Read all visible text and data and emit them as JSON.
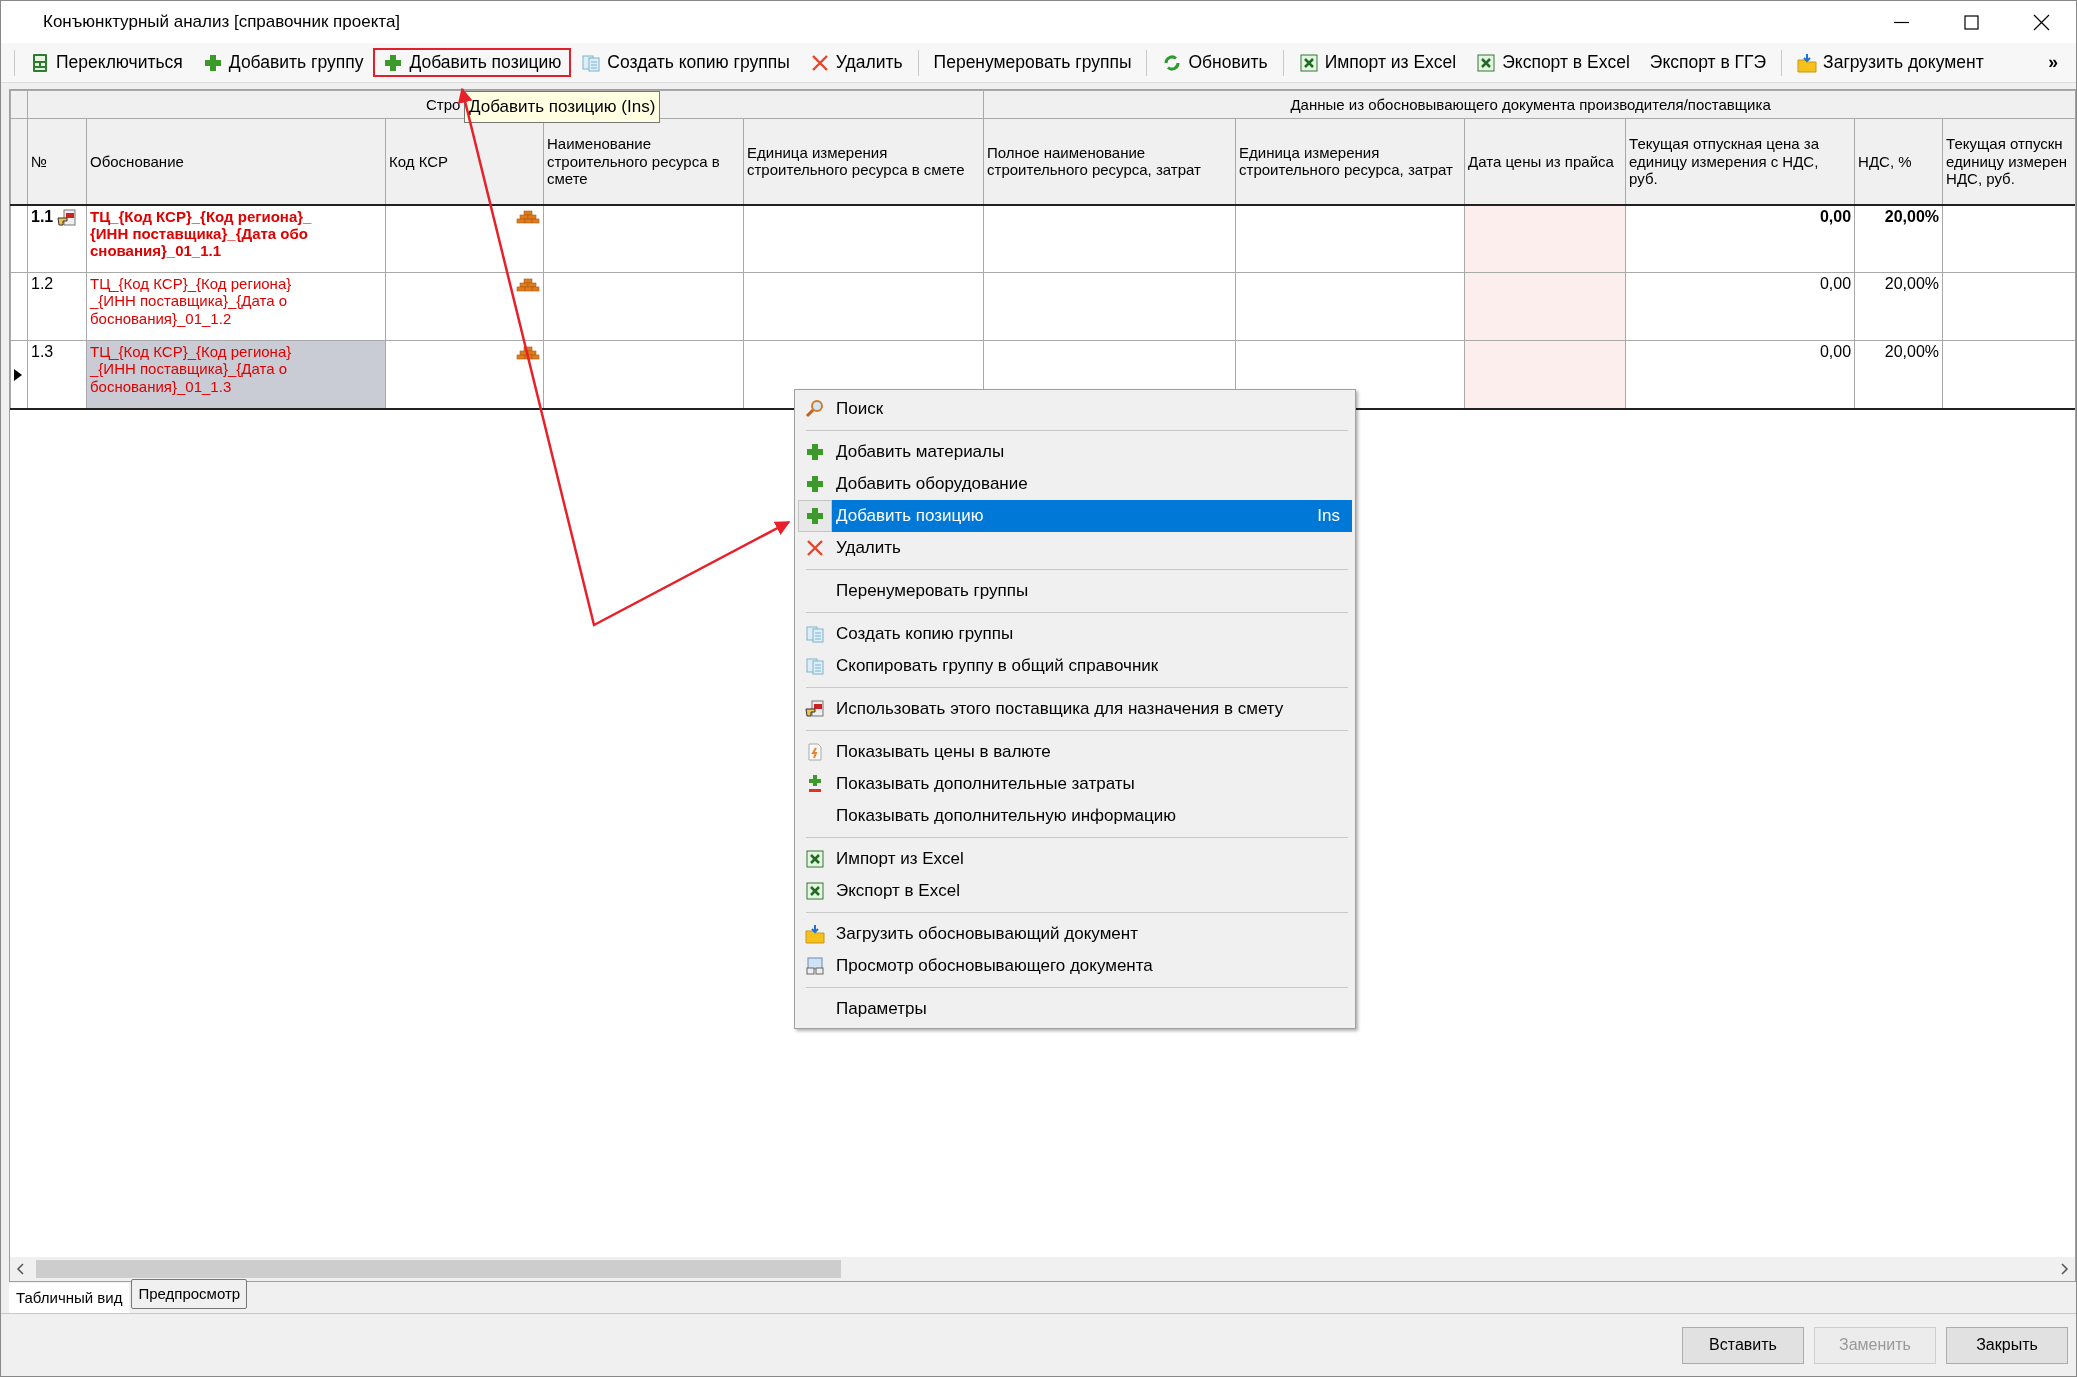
{
  "window": {
    "title": "Конъюнктурный анализ [справочник проекта]"
  },
  "toolbar": [
    {
      "kind": "button",
      "label": "Переключиться",
      "highlighted": false
    },
    {
      "kind": "button",
      "label": "Добавить группу",
      "highlighted": false
    },
    {
      "kind": "button",
      "label": "Добавить позицию",
      "highlighted": true
    },
    {
      "kind": "button",
      "label": "Создать копию группы",
      "highlighted": false
    },
    {
      "kind": "button",
      "label": "Удалить",
      "highlighted": false
    },
    {
      "kind": "separator"
    },
    {
      "kind": "button",
      "label": "Перенумеровать группы",
      "highlighted": false
    },
    {
      "kind": "separator"
    },
    {
      "kind": "button",
      "label": "Обновить",
      "highlighted": false
    },
    {
      "kind": "separator"
    },
    {
      "kind": "button",
      "label": "Импорт из Excel",
      "highlighted": false
    },
    {
      "kind": "button",
      "label": "Экспорт в Excel",
      "highlighted": false
    },
    {
      "kind": "button",
      "label": "Экспорт в ГГЭ",
      "highlighted": false
    },
    {
      "kind": "separator"
    },
    {
      "kind": "button",
      "label": "Загрузить документ",
      "highlighted": false
    }
  ],
  "toolbar_overflow": "»",
  "tooltip": "Добавить позицию (Ins)",
  "table": {
    "groups": [
      {
        "label": "Стро"
      },
      {
        "label": "Данные из обосновывающего документа производителя/поставщика"
      }
    ],
    "columns": [
      "№",
      "Обоснование",
      "Код КСР",
      "Наименование строительного ресурса в смете",
      "Единица измерения строительного ресурса в смете",
      "Полное наименование строительного ресурса, затрат",
      "Единица измерения строительного ресурса, затрат",
      "Дата цены из прайса",
      "Текущая отпускная цена за единицу измерения с НДС, руб.",
      "НДС, %",
      "Текущая отпускн\nединицу измерен\nНДС, руб."
    ],
    "rows": [
      {
        "kind": "group",
        "number": "1.1",
        "basis": "ТЦ_{Код КСР}_{Код региона}_{ИНН поставщика}_{Дата обоснования}_01_1.1",
        "price": "0,00",
        "vat": "20,00%",
        "selected": false
      },
      {
        "kind": "position",
        "number": "1.2",
        "basis": "ТЦ_{Код КСР}_{Код региона}_{ИНН поставщика}_{Дата обоснования}_01_1.2",
        "price": "0,00",
        "vat": "20,00%",
        "selected": false
      },
      {
        "kind": "position",
        "number": "1.3",
        "basis": "ТЦ_{Код КСР}_{Код региона}_{ИНН поставщика}_{Дата обоснования}_01_1.3",
        "price": "0,00",
        "vat": "20,00%",
        "selected": true
      }
    ]
  },
  "context_menu": {
    "items": [
      {
        "kind": "item",
        "label": "Поиск",
        "selected": false
      },
      {
        "kind": "separator"
      },
      {
        "kind": "item",
        "label": "Добавить материалы",
        "selected": false
      },
      {
        "kind": "item",
        "label": "Добавить оборудование",
        "selected": false
      },
      {
        "kind": "item",
        "label": "Добавить позицию",
        "shortcut": "Ins",
        "selected": true
      },
      {
        "kind": "item",
        "label": "Удалить",
        "selected": false
      },
      {
        "kind": "separator"
      },
      {
        "kind": "item",
        "label": "Перенумеровать группы",
        "selected": false
      },
      {
        "kind": "separator"
      },
      {
        "kind": "item",
        "label": "Создать копию группы",
        "selected": false
      },
      {
        "kind": "item",
        "label": "Скопировать группу в общий справочник",
        "selected": false
      },
      {
        "kind": "separator"
      },
      {
        "kind": "item",
        "label": "Использовать этого поставщика для назначения в смету",
        "selected": false
      },
      {
        "kind": "separator"
      },
      {
        "kind": "item",
        "label": "Показывать цены в валюте",
        "selected": false
      },
      {
        "kind": "item",
        "label": "Показывать дополнительные затраты",
        "selected": false
      },
      {
        "kind": "item",
        "label": "Показывать дополнительную информацию",
        "selected": false
      },
      {
        "kind": "separator"
      },
      {
        "kind": "item",
        "label": "Импорт из Excel",
        "selected": false
      },
      {
        "kind": "item",
        "label": "Экспорт в Excel",
        "selected": false
      },
      {
        "kind": "separator"
      },
      {
        "kind": "item",
        "label": "Загрузить обосновывающий документ",
        "selected": false
      },
      {
        "kind": "item",
        "label": "Просмотр обосновывающего документа",
        "selected": false
      },
      {
        "kind": "separator"
      },
      {
        "kind": "item",
        "label": "Параметры",
        "selected": false
      }
    ]
  },
  "tabs": [
    {
      "label": "Табличный вид",
      "selected": true
    },
    {
      "label": "Предпросмотр",
      "selected": false
    }
  ],
  "buttons": [
    {
      "label": "Вставить",
      "disabled": false
    },
    {
      "label": "Заменить",
      "disabled": true
    },
    {
      "label": "Закрыть",
      "disabled": false
    }
  ]
}
